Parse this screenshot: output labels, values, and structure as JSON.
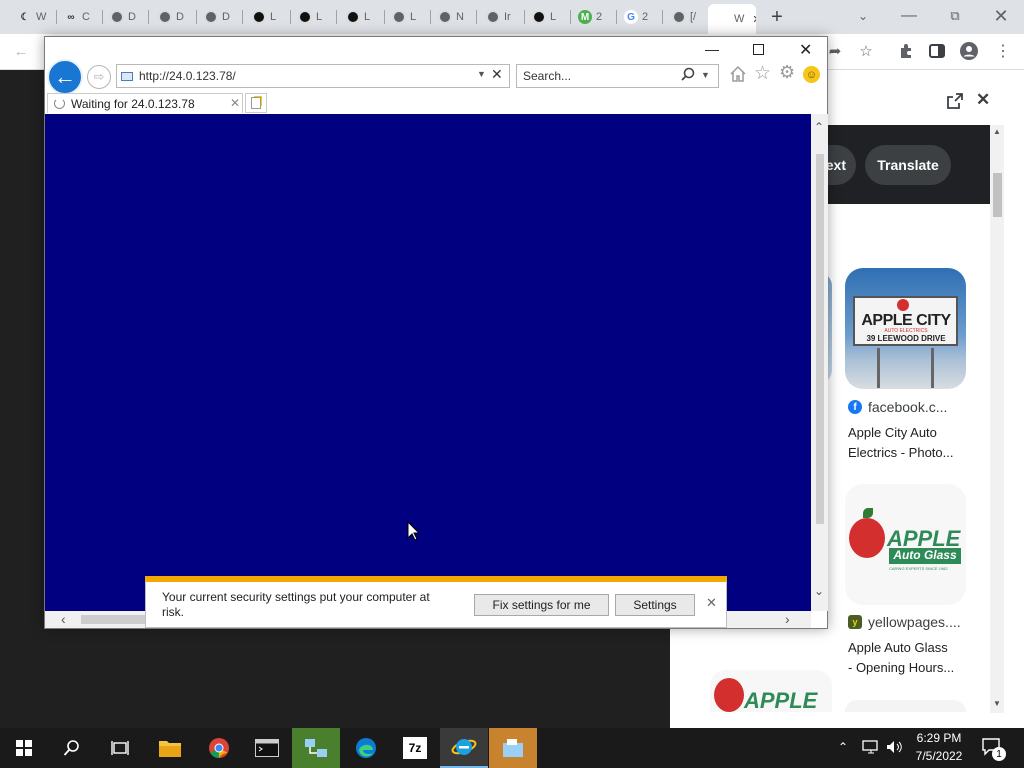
{
  "chrome": {
    "tabs": [
      {
        "label": "W"
      },
      {
        "label": "C"
      },
      {
        "label": "D"
      },
      {
        "label": "D"
      },
      {
        "label": "D"
      },
      {
        "label": "L"
      },
      {
        "label": "L"
      },
      {
        "label": "L"
      },
      {
        "label": "L"
      },
      {
        "label": "N"
      },
      {
        "label": "Ir"
      },
      {
        "label": "L"
      },
      {
        "label": "2"
      },
      {
        "label": "2"
      },
      {
        "label": "[/"
      },
      {
        "label": "W"
      }
    ],
    "new_tab": "+"
  },
  "side_panel": {
    "pills": [
      "ext",
      "Translate"
    ],
    "results": [
      {
        "source": "facebook.c...",
        "title_line1": "Apple City Auto",
        "title_line2": "Electrics - Photo..."
      },
      {
        "source": "yellowpages....",
        "title_line1": "Apple Auto Glass",
        "title_line2": "- Opening Hours..."
      }
    ],
    "thumb1": {
      "main": "APPLE CITY",
      "sub": "AUTO ELECTRICS",
      "addr": "39 LEEWOOD DRIVE"
    },
    "thumb2": {
      "main": "APPLE",
      "sub": "Auto Glass",
      "tag": "CARING EXPERTS SINCE 1982"
    },
    "thumb3": {
      "main": "APPLE"
    }
  },
  "ie": {
    "address": "http://24.0.123.78/",
    "search_placeholder": "Search...",
    "tab_label": "Waiting for 24.0.123.78",
    "content_color": "#000080"
  },
  "notification": {
    "message": "Your current security settings put your computer at risk.",
    "fix_button": "Fix settings for me",
    "settings_button": "Settings"
  },
  "taskbar": {
    "time": "6:29 PM",
    "date": "7/5/2022",
    "notification_count": "1",
    "sevenzip_label": "7z"
  }
}
